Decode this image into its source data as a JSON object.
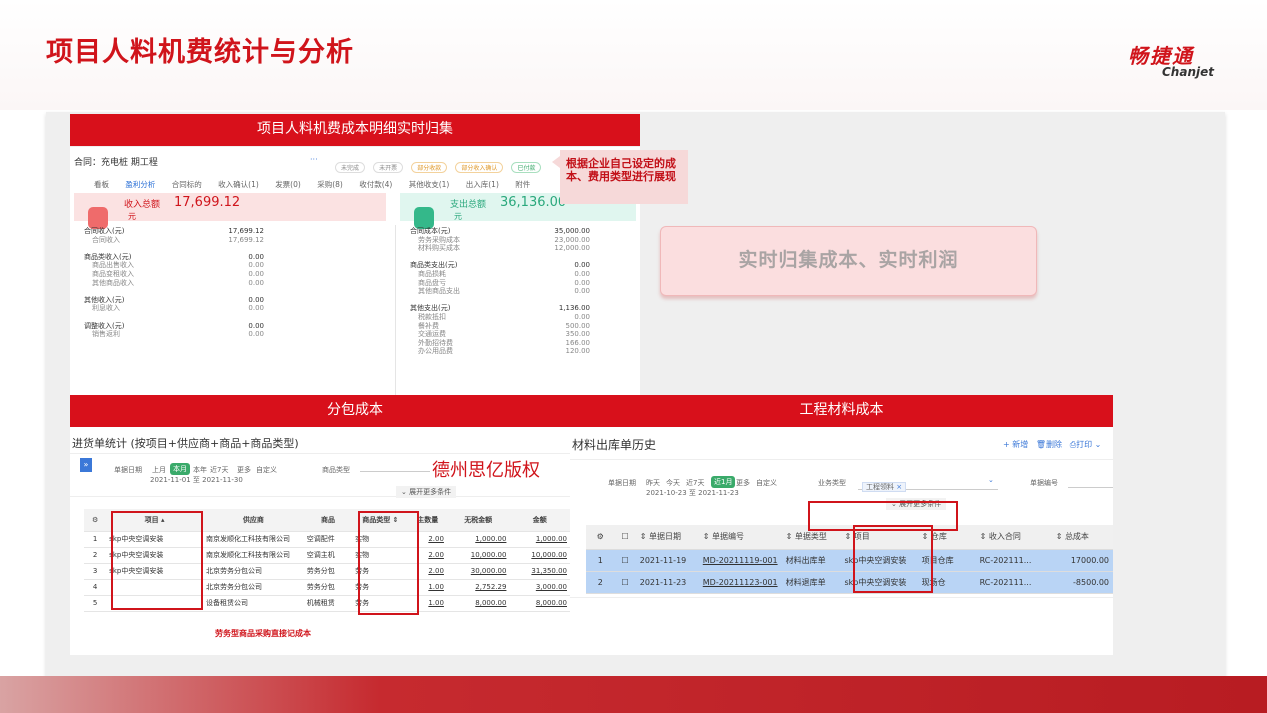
{
  "slide": {
    "title": "项目人料机费统计与分析",
    "logo_cn": "畅捷通",
    "logo_en": "Chanjet",
    "callout": "实时归集成本、实时利润",
    "tip": "根据企业自己设定的成本、费用类型进行展现",
    "watermark": "德州思亿版权",
    "footnote": "劳务型商品采购直接记成本"
  },
  "top_panel": {
    "header": "项目人料机费成本明细实时归集",
    "contract_label": "合同：充电桩",
    "project": "期工程",
    "more": "···",
    "status_pills": [
      "未完成",
      "未开票",
      "部分收款",
      "部分收入确认",
      "已付款"
    ],
    "tabs": [
      "看板",
      "盈利分析",
      "合同标的",
      "收入确认(1)",
      "发票(0)",
      "采购(8)",
      "收付款(4)",
      "其他收支(1)",
      "出入库(1)",
      "附件"
    ],
    "income_label": "收入总额",
    "income_total": "17,699.12",
    "income_unit": "元",
    "expense_label": "支出总额",
    "expense_total": "36,136.00",
    "expense_unit": "元",
    "left_rows": [
      [
        "合同收入(元)",
        "17,699.12",
        true
      ],
      [
        "合同收入",
        "17,699.12",
        false
      ],
      [
        "",
        "",
        false
      ],
      [
        "商品类收入(元)",
        "0.00",
        true
      ],
      [
        "商品出售收入",
        "0.00",
        false
      ],
      [
        "商品变租收入",
        "0.00",
        false
      ],
      [
        "其他商品收入",
        "0.00",
        false
      ],
      [
        "",
        "",
        false
      ],
      [
        "其他收入(元)",
        "0.00",
        true
      ],
      [
        "利息收入",
        "0.00",
        false
      ],
      [
        "",
        "",
        false
      ],
      [
        "调整收入(元)",
        "0.00",
        true
      ],
      [
        "销售返利",
        "0.00",
        false
      ]
    ],
    "right_rows": [
      [
        "合同成本(元)",
        "35,000.00",
        true
      ],
      [
        "劳务采购成本",
        "23,000.00",
        false
      ],
      [
        "材料购买成本",
        "12,000.00",
        false
      ],
      [
        "",
        "",
        false
      ],
      [
        "商品类支出(元)",
        "0.00",
        true
      ],
      [
        "商品损耗",
        "0.00",
        false
      ],
      [
        "商品盘亏",
        "0.00",
        false
      ],
      [
        "其他商品支出",
        "0.00",
        false
      ],
      [
        "",
        "",
        false
      ],
      [
        "其他支出(元)",
        "1,136.00",
        true
      ],
      [
        "税款抵扣",
        "0.00",
        false
      ],
      [
        "餐补费",
        "500.00",
        false
      ],
      [
        "交通运费",
        "350.00",
        false
      ],
      [
        "外勤招待费",
        "166.00",
        false
      ],
      [
        "办公用品费",
        "120.00",
        false
      ]
    ]
  },
  "sub_panel": {
    "header": "分包成本",
    "title": "进货单统计 (按项目+供应商+商品+商品类型)",
    "date_label": "单据日期",
    "date_opts": [
      "上月",
      "本月",
      "本年",
      "近7天",
      "更多",
      "自定义"
    ],
    "date_range": "2021-11-01 至 2021-11-30",
    "type_label": "商品类型",
    "expand": "展开更多条件",
    "columns": [
      "",
      "项目",
      "供应商",
      "商品",
      "商品类型",
      "主数量",
      "无税金额",
      "金额"
    ],
    "rows": [
      [
        "1",
        "skp中央空调安装",
        "南京发顺化工科技有限公司",
        "空调配件",
        "实物",
        "2.00",
        "1,000.00",
        "1,000.00"
      ],
      [
        "2",
        "skp中央空调安装",
        "南京发顺化工科技有限公司",
        "空调主机",
        "实物",
        "2.00",
        "10,000.00",
        "10,000.00"
      ],
      [
        "3",
        "skp中央空调安装",
        "北京劳务分包公司",
        "劳务分包",
        "劳务",
        "2.00",
        "30,000.00",
        "31,350.00"
      ],
      [
        "4",
        "",
        "北京劳务分包公司",
        "劳务分包",
        "劳务",
        "1.00",
        "2,752.29",
        "3,000.00"
      ],
      [
        "5",
        "",
        "设备租赁公司",
        "机械租赁",
        "劳务",
        "1.00",
        "8,000.00",
        "8,000.00"
      ]
    ]
  },
  "mat_panel": {
    "header": "工程材料成本",
    "title": "材料出库单历史",
    "actions": [
      "+ 新增",
      "删除",
      "打印"
    ],
    "date_label": "单据日期",
    "date_opts": [
      "昨天",
      "今天",
      "近7天",
      "近1月",
      "更多",
      "自定义"
    ],
    "date_range": "2021-10-23 至 2021-11-23",
    "biz_label": "业务类型",
    "biz_tag": "工程领料",
    "no_label": "单据编号",
    "expand": "展开更多条件",
    "columns": [
      "",
      "",
      "单据日期",
      "单据编号",
      "单据类型",
      "项目",
      "仓库",
      "收入合同",
      "总成本"
    ],
    "rows": [
      [
        "1",
        "2021-11-19",
        "MD-20211119-001",
        "材料出库单",
        "skp中央空调安装",
        "项目仓库",
        "RC-202111...",
        "17000.00"
      ],
      [
        "2",
        "2021-11-23",
        "MD-20211123-001",
        "材料退库单",
        "skp中央空调安装",
        "现场仓",
        "RC-202111...",
        "-8500.00"
      ]
    ]
  },
  "colors": {
    "brand_red": "#d0141b",
    "select_blue": "#b9d4f5"
  }
}
